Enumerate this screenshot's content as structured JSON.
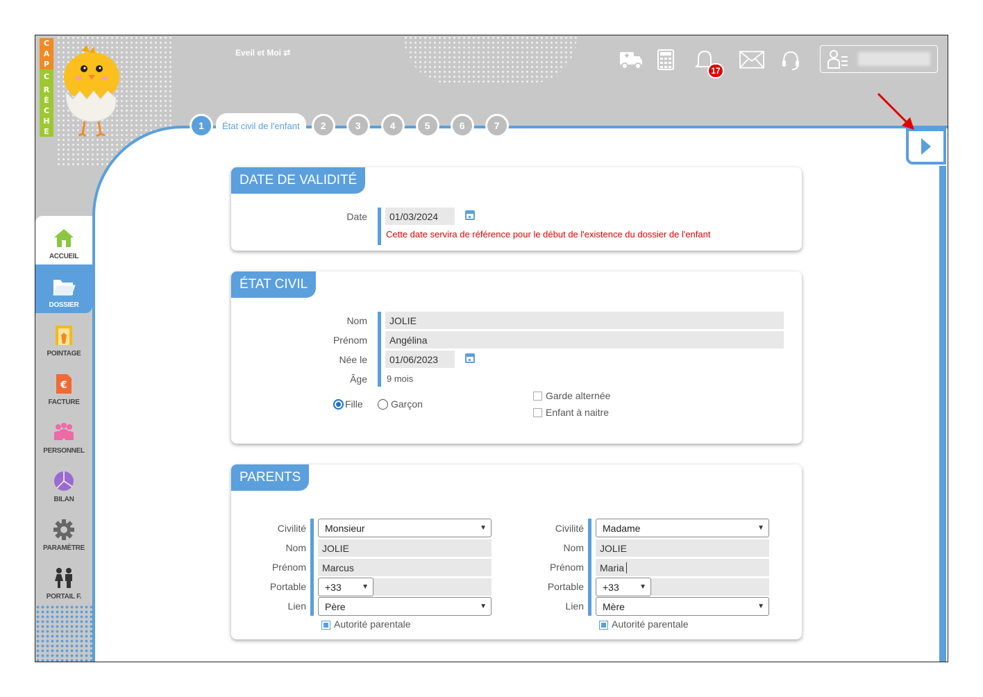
{
  "app": {
    "title": "Eveil et Moi",
    "logo_letters": [
      "C",
      "A",
      "P",
      "C",
      "R",
      "È",
      "C",
      "H",
      "E"
    ],
    "notification_count": "17"
  },
  "stepper": {
    "steps": [
      "1",
      "2",
      "3",
      "4",
      "5",
      "6",
      "7"
    ],
    "active_label": "État civil de l'enfant"
  },
  "sidebar": {
    "items": [
      {
        "label": "ACCUEIL",
        "icon": "home-icon"
      },
      {
        "label": "DOSSIER",
        "icon": "folder-icon"
      },
      {
        "label": "POINTAGE",
        "icon": "door-icon"
      },
      {
        "label": "FACTURE",
        "icon": "invoice-icon"
      },
      {
        "label": "PERSONNEL",
        "icon": "staff-icon"
      },
      {
        "label": "BILAN",
        "icon": "pie-chart-icon"
      },
      {
        "label": "PARAMÈTRE",
        "icon": "gear-icon"
      },
      {
        "label": "PORTAIL F.",
        "icon": "family-icon"
      }
    ]
  },
  "validite": {
    "title": "DATE DE VALIDITÉ",
    "date_label": "Date",
    "date_value": "01/03/2024",
    "note": "Cette date servira de référence pour le début de l'existence du dossier de l'enfant"
  },
  "etat_civil": {
    "title": "ÉTAT CIVIL",
    "nom_label": "Nom",
    "nom_value": "JOLIE",
    "prenom_label": "Prénom",
    "prenom_value": "Angélina",
    "nee_label": "Née le",
    "nee_value": "01/06/2023",
    "age_label": "Âge",
    "age_value": "9 mois",
    "fille_label": "Fille",
    "garcon_label": "Garçon",
    "garde_label": "Garde alternée",
    "enfant_label": "Enfant à naitre"
  },
  "parents": {
    "title": "PARENTS",
    "labels": {
      "civilite": "Civilité",
      "nom": "Nom",
      "prenom": "Prénom",
      "portable": "Portable",
      "lien": "Lien",
      "autorite": "Autorité parentale"
    },
    "p1": {
      "civilite": "Monsieur",
      "nom": "JOLIE",
      "prenom": "Marcus",
      "indicatif": "+33",
      "lien": "Père"
    },
    "p2": {
      "civilite": "Madame",
      "nom": "JOLIE",
      "prenom": "Maria",
      "indicatif": "+33",
      "lien": "Mère"
    }
  },
  "colors": {
    "accent": "#5b9fdc",
    "badge": "#e00000",
    "warning_text": "#e00000"
  }
}
